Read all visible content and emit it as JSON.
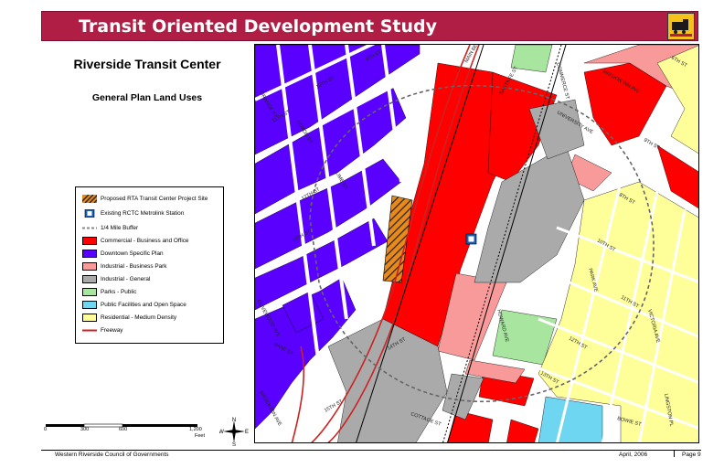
{
  "header": {
    "title": "Transit Oriented Development Study"
  },
  "map": {
    "title": "Riverside Transit Center",
    "subtitle": "General Plan Land Uses"
  },
  "legend": {
    "items": [
      {
        "label": "Proposed RTA Transit Center Project Site",
        "swatch": "hatch",
        "color": "#e88a1a"
      },
      {
        "label": "Existing RCTC Metrolink Station",
        "swatch": "station",
        "color": "#1d5fb4"
      },
      {
        "label": "1/4 Mile Buffer",
        "swatch": "dashed",
        "color": "#888888"
      },
      {
        "label": "Commercial - Business and Office",
        "swatch": "fill",
        "color": "#ff0000"
      },
      {
        "label": "Downtown Specific Plan",
        "swatch": "fill",
        "color": "#5a00ff"
      },
      {
        "label": "Industrial - Business Park",
        "swatch": "fill",
        "color": "#f99a9a"
      },
      {
        "label": "Industrial - General",
        "swatch": "fill",
        "color": "#aaaaaa"
      },
      {
        "label": "Parks - Public",
        "swatch": "fill",
        "color": "#a8e6a0"
      },
      {
        "label": "Public Facilities and Open Space",
        "swatch": "fill",
        "color": "#6ed6f0"
      },
      {
        "label": "Residential - Medium Density",
        "swatch": "fill",
        "color": "#ffff9a"
      },
      {
        "label": "Freeway",
        "swatch": "line",
        "color": "#cc2222"
      }
    ]
  },
  "streets": {
    "s9th_nw": "9TH ST",
    "s10th_nw": "10TH ST",
    "s11th_nw": "11TH ST",
    "s12th_nw": "12TH ST",
    "s13th_nw": "13TH ST",
    "s14th": "14TH ST",
    "s15th": "15TH ST",
    "s6th_ne": "6TH ST",
    "s8th_ne": "8TH ST",
    "s10th_ne": "10TH ST",
    "s11th_ne": "11TH ST",
    "s12th_ne": "12TH ST",
    "s13th_ne": "13TH ST",
    "s9th_ne": "9TH ST",
    "orange": "ORANGE ST",
    "lemon": "LEMON ST",
    "lime": "LIME ST",
    "olivewood": "OLIVEWOOD AVE",
    "nane": "NANE ST",
    "brockton": "BROCKTON AVE",
    "mission": "MISSION INN AVE",
    "university": "UNIVERSITY AVE",
    "commerce": "COMMERCE ST",
    "santafe": "SANTA FE ST",
    "howard": "HOWARD AVE",
    "park": "PARK AVE",
    "victoria": "VICTORIA AVE",
    "cottage": "COTTAGE ST",
    "bowie": "BOWIE ST",
    "lingston": "LINGSTON PL",
    "mainbeach": "MAIN BEACH ST"
  },
  "scale": {
    "labels": [
      "0",
      "300",
      "600",
      "1,200"
    ],
    "unit": "Feet"
  },
  "north_arrow": {
    "n": "N",
    "s": "S",
    "e": "E",
    "w": "W"
  },
  "footer": {
    "left": "Western Riverside Council of Governments",
    "date": "April, 2006",
    "page": "Page 9"
  }
}
